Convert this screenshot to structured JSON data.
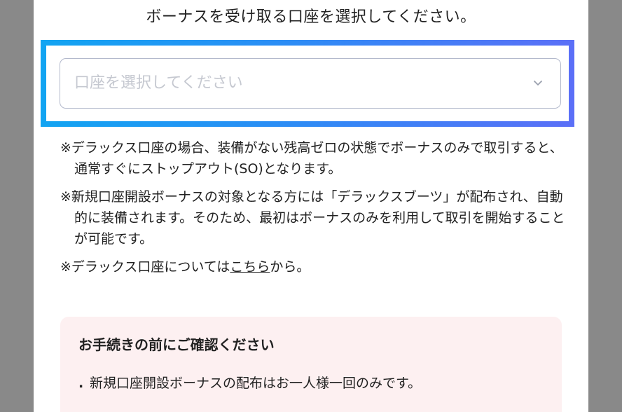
{
  "modal": {
    "heading": "ボーナスを受け取る口座を選択してください。"
  },
  "account_select": {
    "placeholder": "口座を選択してください",
    "icon": "chevron-down-icon"
  },
  "notes": {
    "note1": "※デラックス口座の場合、装備がない残高ゼロの状態でボーナスのみで取引すると、通常すぐにストップアウト(SO)となります。",
    "note2": "※新規口座開設ボーナスの対象となる方には「デラックスブーツ」が配布され、自動的に装備されます。そのため、最初はボーナスのみを利用して取引を開始することが可能です。",
    "note3_prefix": "※デラックス口座については",
    "note3_link": "こちら",
    "note3_suffix": "から。"
  },
  "confirm": {
    "title": "お手続きの前にご確認ください",
    "bullet": ".",
    "item1": "新規口座開設ボーナスの配布はお一人様一回のみです。"
  },
  "colors": {
    "highlight_start": "#12a4f2",
    "highlight_end": "#5b6ff7",
    "confirm_bg": "#fdf0f1",
    "backdrop": "#898989"
  }
}
